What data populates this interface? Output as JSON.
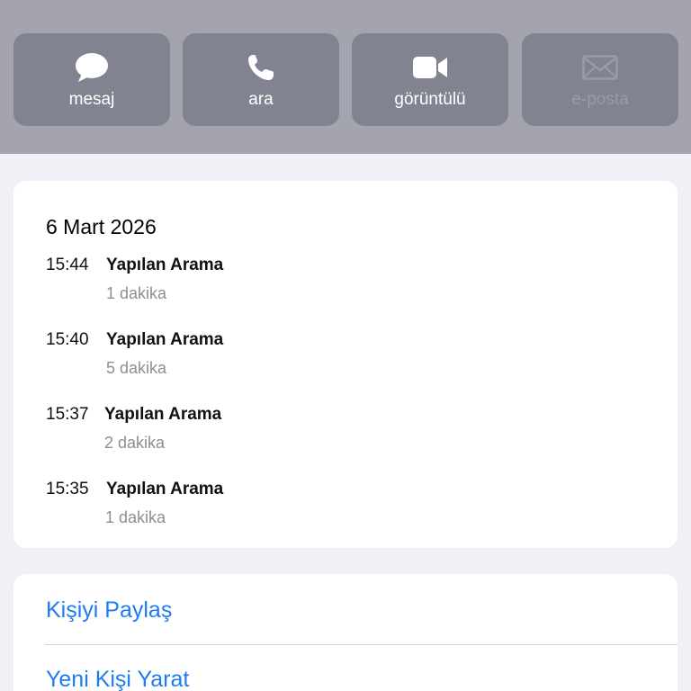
{
  "actions": [
    {
      "label": "mesaj",
      "icon": "message-bubble-icon",
      "enabled": true
    },
    {
      "label": "ara",
      "icon": "phone-icon",
      "enabled": true
    },
    {
      "label": "görüntülü",
      "icon": "video-camera-icon",
      "enabled": true
    },
    {
      "label": "e-posta",
      "icon": "mail-envelope-icon",
      "enabled": false
    }
  ],
  "history": {
    "date": "6 Mart 2026",
    "calls": [
      {
        "time": "15:44",
        "type": "Yapılan Arama",
        "duration": "1 dakika"
      },
      {
        "time": "15:40",
        "type": "Yapılan Arama",
        "duration": "5 dakika"
      },
      {
        "time": "15:37",
        "type": "Yapılan Arama",
        "duration": "2 dakika"
      },
      {
        "time": "15:35",
        "type": "Yapılan Arama",
        "duration": "1 dakika"
      }
    ]
  },
  "contact_actions": {
    "share": "Kişiyi Paylaş",
    "create": "Yeni Kişi Yarat"
  },
  "colors": {
    "header_bg": "#a3a4ae",
    "button_bg": "#828390",
    "link_blue": "#1d7cf2",
    "page_bg": "#f1f0f6"
  }
}
